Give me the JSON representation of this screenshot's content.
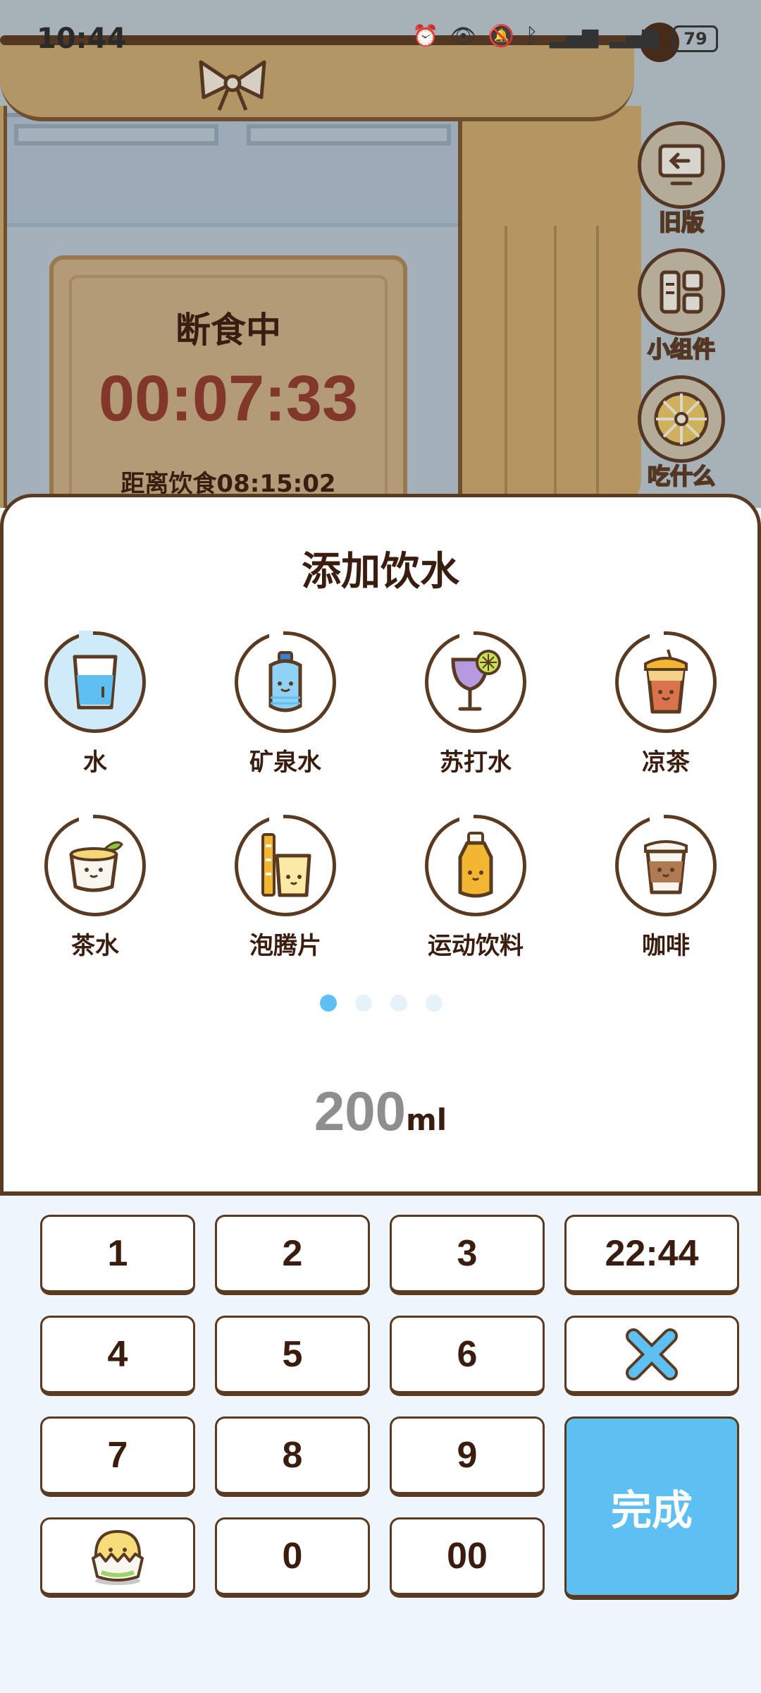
{
  "status_bar": {
    "time": "10:44",
    "battery": "79"
  },
  "fasting": {
    "status": "断食中",
    "timer": "00:07:33",
    "until_eating": "距离饮食08:15:02"
  },
  "side_buttons": [
    {
      "label": "旧版",
      "icon": "back-screen-icon"
    },
    {
      "label": "小组件",
      "icon": "widget-icon"
    },
    {
      "label": "吃什么",
      "icon": "wheel-icon"
    }
  ],
  "sheet": {
    "title": "添加饮水",
    "drinks": [
      {
        "label": "水",
        "icon": "water-glass-icon",
        "selected": true
      },
      {
        "label": "矿泉水",
        "icon": "water-bottle-icon"
      },
      {
        "label": "苏打水",
        "icon": "soda-glass-icon"
      },
      {
        "label": "凉茶",
        "icon": "iced-tea-icon"
      },
      {
        "label": "茶水",
        "icon": "tea-cup-icon"
      },
      {
        "label": "泡腾片",
        "icon": "effervescent-icon"
      },
      {
        "label": "运动饮料",
        "icon": "sports-drink-icon"
      },
      {
        "label": "咖啡",
        "icon": "coffee-cup-icon"
      }
    ],
    "page_dots": 4,
    "active_page": 1,
    "amount_value": "200",
    "amount_unit": "ml"
  },
  "keypad": {
    "keys": [
      "1",
      "2",
      "3",
      "4",
      "5",
      "6",
      "7",
      "8",
      "9",
      "0",
      "00"
    ],
    "time": "22:44",
    "done": "完成",
    "delete_icon": "delete-x-icon",
    "mascot_icon": "chick-mascot-icon"
  },
  "colors": {
    "accent": "#5ec0f2",
    "outline": "#5b3a22",
    "timer": "#8f3a2c"
  }
}
